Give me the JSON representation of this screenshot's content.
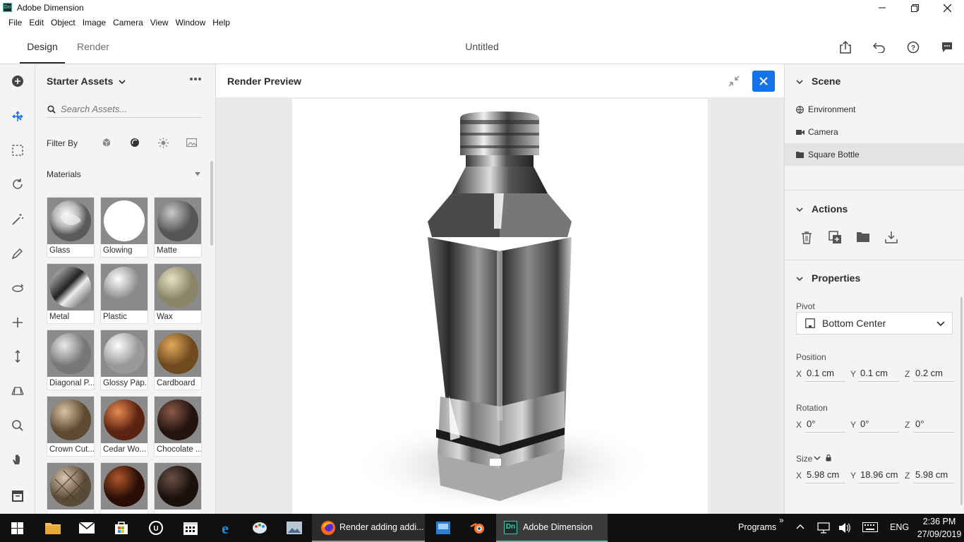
{
  "window": {
    "title": "Adobe Dimension",
    "logo": "Dn"
  },
  "menu": [
    "File",
    "Edit",
    "Object",
    "Image",
    "Camera",
    "View",
    "Window",
    "Help"
  ],
  "tabs": {
    "design": "Design",
    "render": "Render"
  },
  "doc_title": "Untitled",
  "assets": {
    "title": "Starter Assets",
    "search_placeholder": "Search Assets...",
    "filter_label": "Filter By",
    "section": "Materials",
    "materials": [
      {
        "name": "Glass",
        "color": "#b8b8b8"
      },
      {
        "name": "Glowing",
        "color": "#ffffff"
      },
      {
        "name": "Matte",
        "color": "#9a9a9a"
      },
      {
        "name": "Metal",
        "color": "#5a5a5a"
      },
      {
        "name": "Plastic",
        "color": "#c8c8c8"
      },
      {
        "name": "Wax",
        "color": "#c9c2a0"
      },
      {
        "name": "Diagonal P...",
        "color": "#b0b0b0"
      },
      {
        "name": "Glossy Pap...",
        "color": "#cfcfcf"
      },
      {
        "name": "Cardboard",
        "color": "#b8833e"
      },
      {
        "name": "Crown Cut...",
        "color": "#a48c6c"
      },
      {
        "name": "Cedar Wo...",
        "color": "#a0522d"
      },
      {
        "name": "Chocolate ...",
        "color": "#4b2f26"
      },
      {
        "name": "",
        "color": "#9c8a72"
      },
      {
        "name": "",
        "color": "#6a2e1e"
      },
      {
        "name": "",
        "color": "#3a2a24"
      }
    ]
  },
  "preview": {
    "title": "Render Preview"
  },
  "scene": {
    "title": "Scene",
    "items": [
      {
        "label": "Environment",
        "icon": "globe-icon"
      },
      {
        "label": "Camera",
        "icon": "camera-icon"
      },
      {
        "label": "Square Bottle",
        "icon": "folder-icon"
      }
    ]
  },
  "actions": {
    "title": "Actions"
  },
  "properties": {
    "title": "Properties",
    "pivot_label": "Pivot",
    "pivot_value": "Bottom Center",
    "position_label": "Position",
    "position": {
      "x": "0.1 cm",
      "y": "0.1 cm",
      "z": "0.2 cm"
    },
    "rotation_label": "Rotation",
    "rotation": {
      "x": "0°",
      "y": "0°",
      "z": "0°"
    },
    "size_label": "Size",
    "size": {
      "x": "5.98 cm",
      "y": "18.96 cm",
      "z": "5.98 cm"
    },
    "axes": {
      "x": "X",
      "y": "Y",
      "z": "Z"
    }
  },
  "taskbar": {
    "firefox_label": "Render adding addi...",
    "dimension_label": "Adobe Dimension",
    "programs": "Programs",
    "chevron": "»",
    "lang": "ENG",
    "time": "2:36 PM",
    "date": "27/09/2019"
  },
  "colors": {
    "accent": "#1473e6",
    "taskbar": "#101010",
    "dn_green": "#49c6a7"
  }
}
